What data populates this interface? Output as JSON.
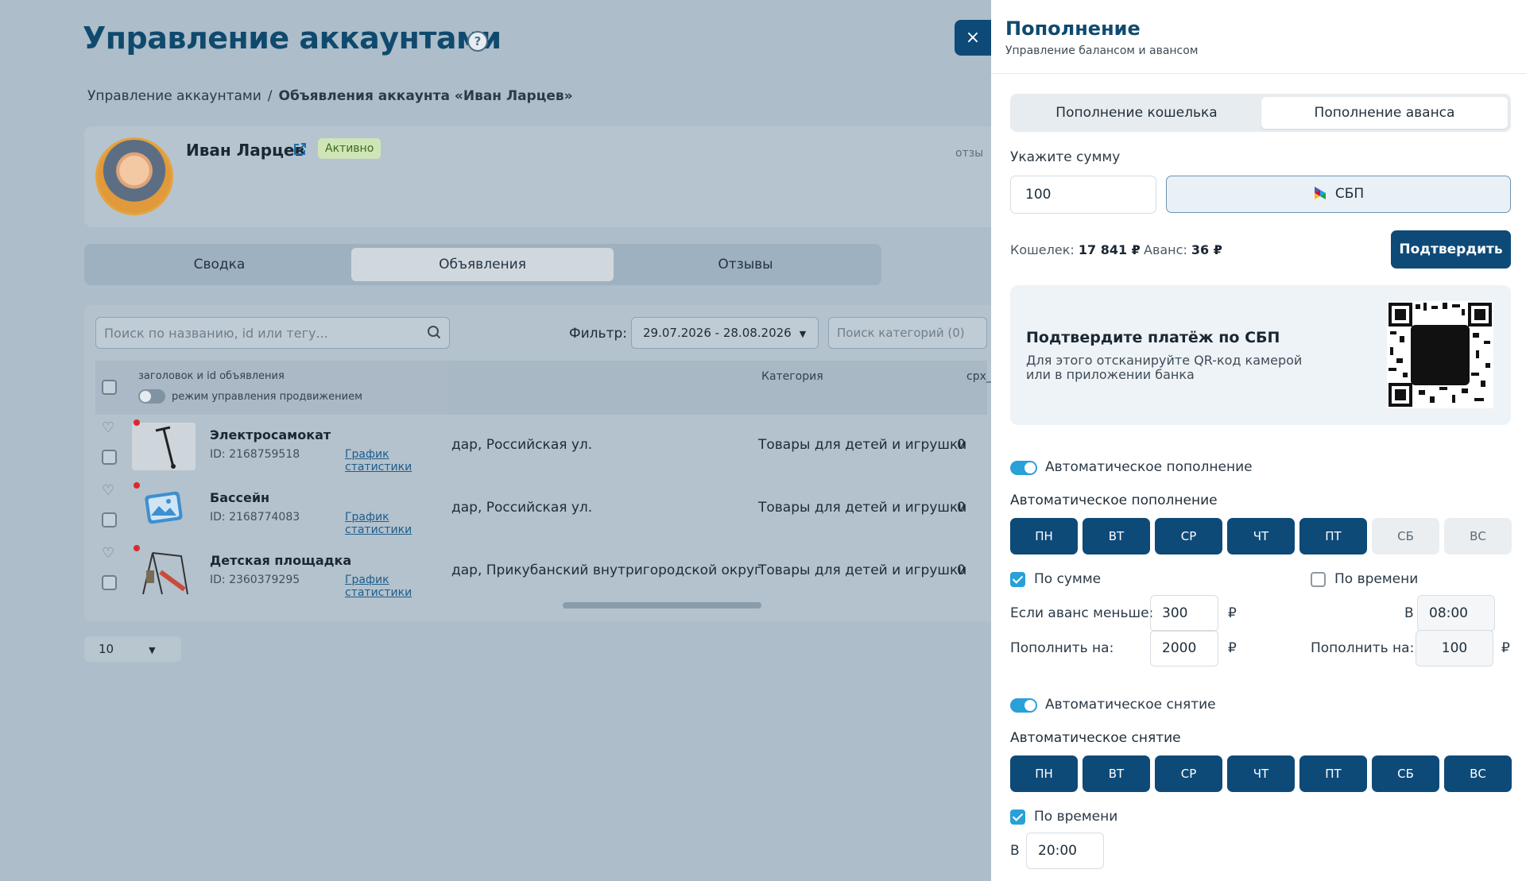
{
  "page": {
    "title": "Управление аккаунтами",
    "help_icon_glyph": "?",
    "breadcrumb": {
      "root": "Управление аккаунтами",
      "separator": "/",
      "current": "Объявления аккаунта «Иван Ларцев»"
    },
    "profile": {
      "name": "Иван Ларцев",
      "status": "Активно",
      "reviews_cut": "отзы"
    },
    "tabs": [
      "Сводка",
      "Объявления",
      "Отзывы"
    ],
    "active_tab": "Объявления",
    "search": {
      "placeholder": "Поиск по названию, id или тегу..."
    },
    "filter": {
      "label": "Фильтр:",
      "date_range": "29.07.2026 - 28.08.2026",
      "category_placeholder": "Поиск категорий (0)"
    },
    "table": {
      "header_title": "заголовок и id объявления",
      "header_toggle_label": "режим управления продвижением",
      "col_category": "Категория",
      "col_cpx": "cpx_pr",
      "rows": [
        {
          "title": "Электросамокат",
          "id": "ID: 2168759518",
          "stats_link": "График статистики",
          "address": "дар, Российская ул.",
          "category": "Товары для детей и игрушки",
          "cpx": "0"
        },
        {
          "title": "Бассейн",
          "id": "ID: 2168774083",
          "stats_link": "График статистики",
          "address": "дар, Российская ул.",
          "category": "Товары для детей и игрушки",
          "cpx": "0"
        },
        {
          "title": "Детская площадка",
          "id": "ID: 2360379295",
          "stats_link": "График статистики",
          "address": "дар, Прикубанский внутригородской округ",
          "category": "Товары для детей и игрушки",
          "cpx": "0"
        }
      ]
    },
    "per_page": "10"
  },
  "drawer": {
    "close_glyph": "×",
    "title": "Пополнение",
    "subtitle": "Управление балансом и авансом",
    "tabs": [
      "Пополнение кошелька",
      "Пополнение аванса"
    ],
    "active_tab": "Пополнение аванса",
    "amount_label": "Укажите сумму",
    "amount_value": "100",
    "sbp_button": "СБП",
    "wallet_label": "Кошелек:",
    "wallet_value": "17 841 ₽",
    "advance_label": "Аванс:",
    "advance_value": "36 ₽",
    "confirm_button": "Подтвердить",
    "qr": {
      "title": "Подтвердите платёж по СБП",
      "text": "Для этого отсканируйте QR-код камерой или в приложении банка"
    },
    "auto_topup": {
      "toggle_label": "Автоматическое пополнение",
      "toggle_on": true,
      "section_title": "Автоматическое пополнение",
      "days": [
        {
          "label": "ПН",
          "on": true
        },
        {
          "label": "ВТ",
          "on": true
        },
        {
          "label": "СР",
          "on": true
        },
        {
          "label": "ЧТ",
          "on": true
        },
        {
          "label": "ПТ",
          "on": true
        },
        {
          "label": "СБ",
          "on": false
        },
        {
          "label": "ВС",
          "on": false
        }
      ],
      "by_amount_label": "По сумме",
      "by_amount_checked": true,
      "by_time_label": "По времени",
      "by_time_checked": false,
      "if_less_label": "Если аванс меньше:",
      "if_less_value": "300",
      "topup_by_label": "Пополнить на:",
      "topup_by_value": "2000",
      "time_prefix": "В",
      "time_value": "08:00",
      "time_topup_label": "Пополнить на:",
      "time_topup_value": "100",
      "currency": "₽"
    },
    "auto_withdraw": {
      "toggle_label": "Автоматическое снятие",
      "toggle_on": true,
      "section_title": "Автоматическое снятие",
      "days": [
        {
          "label": "ПН",
          "on": true
        },
        {
          "label": "ВТ",
          "on": true
        },
        {
          "label": "СР",
          "on": true
        },
        {
          "label": "ЧТ",
          "on": true
        },
        {
          "label": "ПТ",
          "on": true
        },
        {
          "label": "СБ",
          "on": true
        },
        {
          "label": "ВС",
          "on": true
        }
      ],
      "by_time_label": "По времени",
      "by_time_checked": true,
      "time_prefix": "В",
      "time_value": "20:00"
    }
  },
  "colors": {
    "brand": "#0e4a78",
    "accent": "#2aa0d8",
    "badge_bg": "#cfe5b8",
    "dot": "#d92b2b"
  }
}
